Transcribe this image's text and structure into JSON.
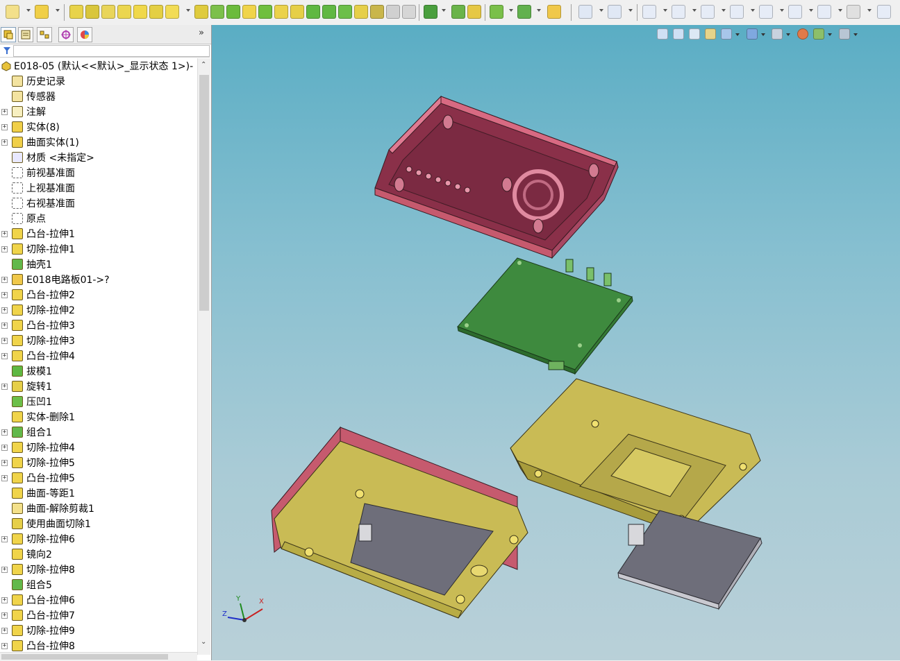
{
  "app": {
    "model_title": "E018-05  (默认<<默认>_显示状态 1>)-"
  },
  "feature_tree": {
    "items": [
      {
        "label": "历史记录",
        "icon": "history-icon",
        "expandable": false
      },
      {
        "label": "传感器",
        "icon": "sensor-icon",
        "expandable": false
      },
      {
        "label": "注解",
        "icon": "annotation-icon",
        "expandable": true
      },
      {
        "label": "实体(8)",
        "icon": "solid-bodies-icon",
        "expandable": true
      },
      {
        "label": "曲面实体(1)",
        "icon": "surface-bodies-icon",
        "expandable": true
      },
      {
        "label": "材质 <未指定>",
        "icon": "material-icon",
        "expandable": false
      },
      {
        "label": "前视基准面",
        "icon": "plane-icon",
        "expandable": false
      },
      {
        "label": "上视基准面",
        "icon": "plane-icon",
        "expandable": false
      },
      {
        "label": "右视基准面",
        "icon": "plane-icon",
        "expandable": false
      },
      {
        "label": "原点",
        "icon": "origin-icon",
        "expandable": false
      },
      {
        "label": "凸台-拉伸1",
        "icon": "boss-extrude-icon",
        "expandable": true
      },
      {
        "label": "切除-拉伸1",
        "icon": "cut-extrude-icon",
        "expandable": true
      },
      {
        "label": "抽壳1",
        "icon": "shell-icon",
        "expandable": false
      },
      {
        "label": "E018电路板01->?",
        "icon": "part-icon",
        "expandable": true
      },
      {
        "label": "凸台-拉伸2",
        "icon": "boss-extrude-icon",
        "expandable": true
      },
      {
        "label": "切除-拉伸2",
        "icon": "cut-extrude-icon",
        "expandable": true
      },
      {
        "label": "凸台-拉伸3",
        "icon": "boss-extrude-icon",
        "expandable": true
      },
      {
        "label": "切除-拉伸3",
        "icon": "cut-extrude-icon",
        "expandable": true
      },
      {
        "label": "凸台-拉伸4",
        "icon": "boss-extrude-icon",
        "expandable": true
      },
      {
        "label": "拔模1",
        "icon": "draft-icon",
        "expandable": false
      },
      {
        "label": "旋转1",
        "icon": "revolve-icon",
        "expandable": true
      },
      {
        "label": "压凹1",
        "icon": "indent-icon",
        "expandable": false
      },
      {
        "label": "实体-删除1",
        "icon": "delete-body-icon",
        "expandable": false
      },
      {
        "label": "组合1",
        "icon": "combine-icon",
        "expandable": true
      },
      {
        "label": "切除-拉伸4",
        "icon": "cut-extrude-icon",
        "expandable": true
      },
      {
        "label": "切除-拉伸5",
        "icon": "cut-extrude-icon",
        "expandable": true
      },
      {
        "label": "凸台-拉伸5",
        "icon": "boss-extrude-icon",
        "expandable": true
      },
      {
        "label": "曲面-等距1",
        "icon": "offset-surface-icon",
        "expandable": false
      },
      {
        "label": "曲面-解除剪裁1",
        "icon": "untrim-surface-icon",
        "expandable": false
      },
      {
        "label": "使用曲面切除1",
        "icon": "surface-cut-icon",
        "expandable": false
      },
      {
        "label": "切除-拉伸6",
        "icon": "cut-extrude-icon",
        "expandable": true
      },
      {
        "label": "镜向2",
        "icon": "mirror-icon",
        "expandable": false
      },
      {
        "label": "切除-拉伸8",
        "icon": "cut-extrude-icon",
        "expandable": true
      },
      {
        "label": "组合5",
        "icon": "combine-icon",
        "expandable": false
      },
      {
        "label": "凸台-拉伸6",
        "icon": "boss-extrude-icon",
        "expandable": true
      },
      {
        "label": "凸台-拉伸7",
        "icon": "boss-extrude-icon",
        "expandable": true
      },
      {
        "label": "切除-拉伸9",
        "icon": "cut-extrude-icon",
        "expandable": true
      },
      {
        "label": "凸台-拉伸8",
        "icon": "boss-extrude-icon",
        "expandable": true
      }
    ]
  },
  "triad": {
    "x": "X",
    "y": "Y",
    "z": "Z"
  },
  "colors": {
    "viewport_top": "#5aadc4",
    "viewport_bottom": "#b9d0d8",
    "housing_pink": "#c65a6e",
    "housing_yellow": "#b8ac45",
    "pcb_green": "#3e8a3e",
    "cover_gray": "#6e6e7a"
  }
}
